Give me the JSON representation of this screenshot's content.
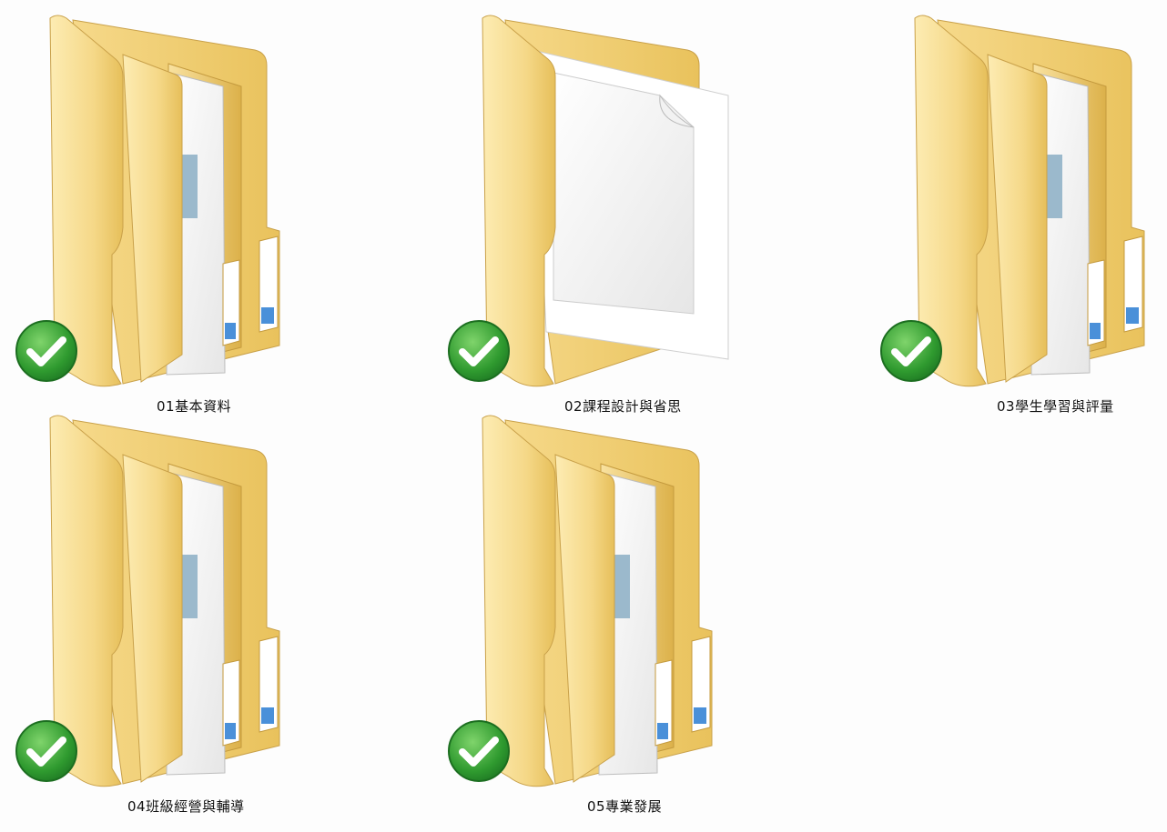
{
  "folders": [
    {
      "name": "01基本資料",
      "icon": "folder-with-documents-icon",
      "status": "synced",
      "status_icon": "green-check-icon"
    },
    {
      "name": "02課程設計與省思",
      "icon": "folder-with-blank-page-icon",
      "status": "synced",
      "status_icon": "green-check-icon"
    },
    {
      "name": "03學生學習與評量",
      "icon": "folder-with-documents-icon",
      "status": "synced",
      "status_icon": "green-check-icon"
    },
    {
      "name": "04班級經營與輔導",
      "icon": "folder-with-documents-icon",
      "status": "synced",
      "status_icon": "green-check-icon"
    },
    {
      "name": "05專業發展",
      "icon": "folder-with-documents-icon",
      "status": "synced",
      "status_icon": "green-check-icon"
    }
  ],
  "colors": {
    "folder_light": "#fbe7a6",
    "folder_mid": "#f3d27a",
    "folder_dark": "#e2b94f",
    "check_green": "#3aa53a",
    "background": "#fdfdfd"
  }
}
